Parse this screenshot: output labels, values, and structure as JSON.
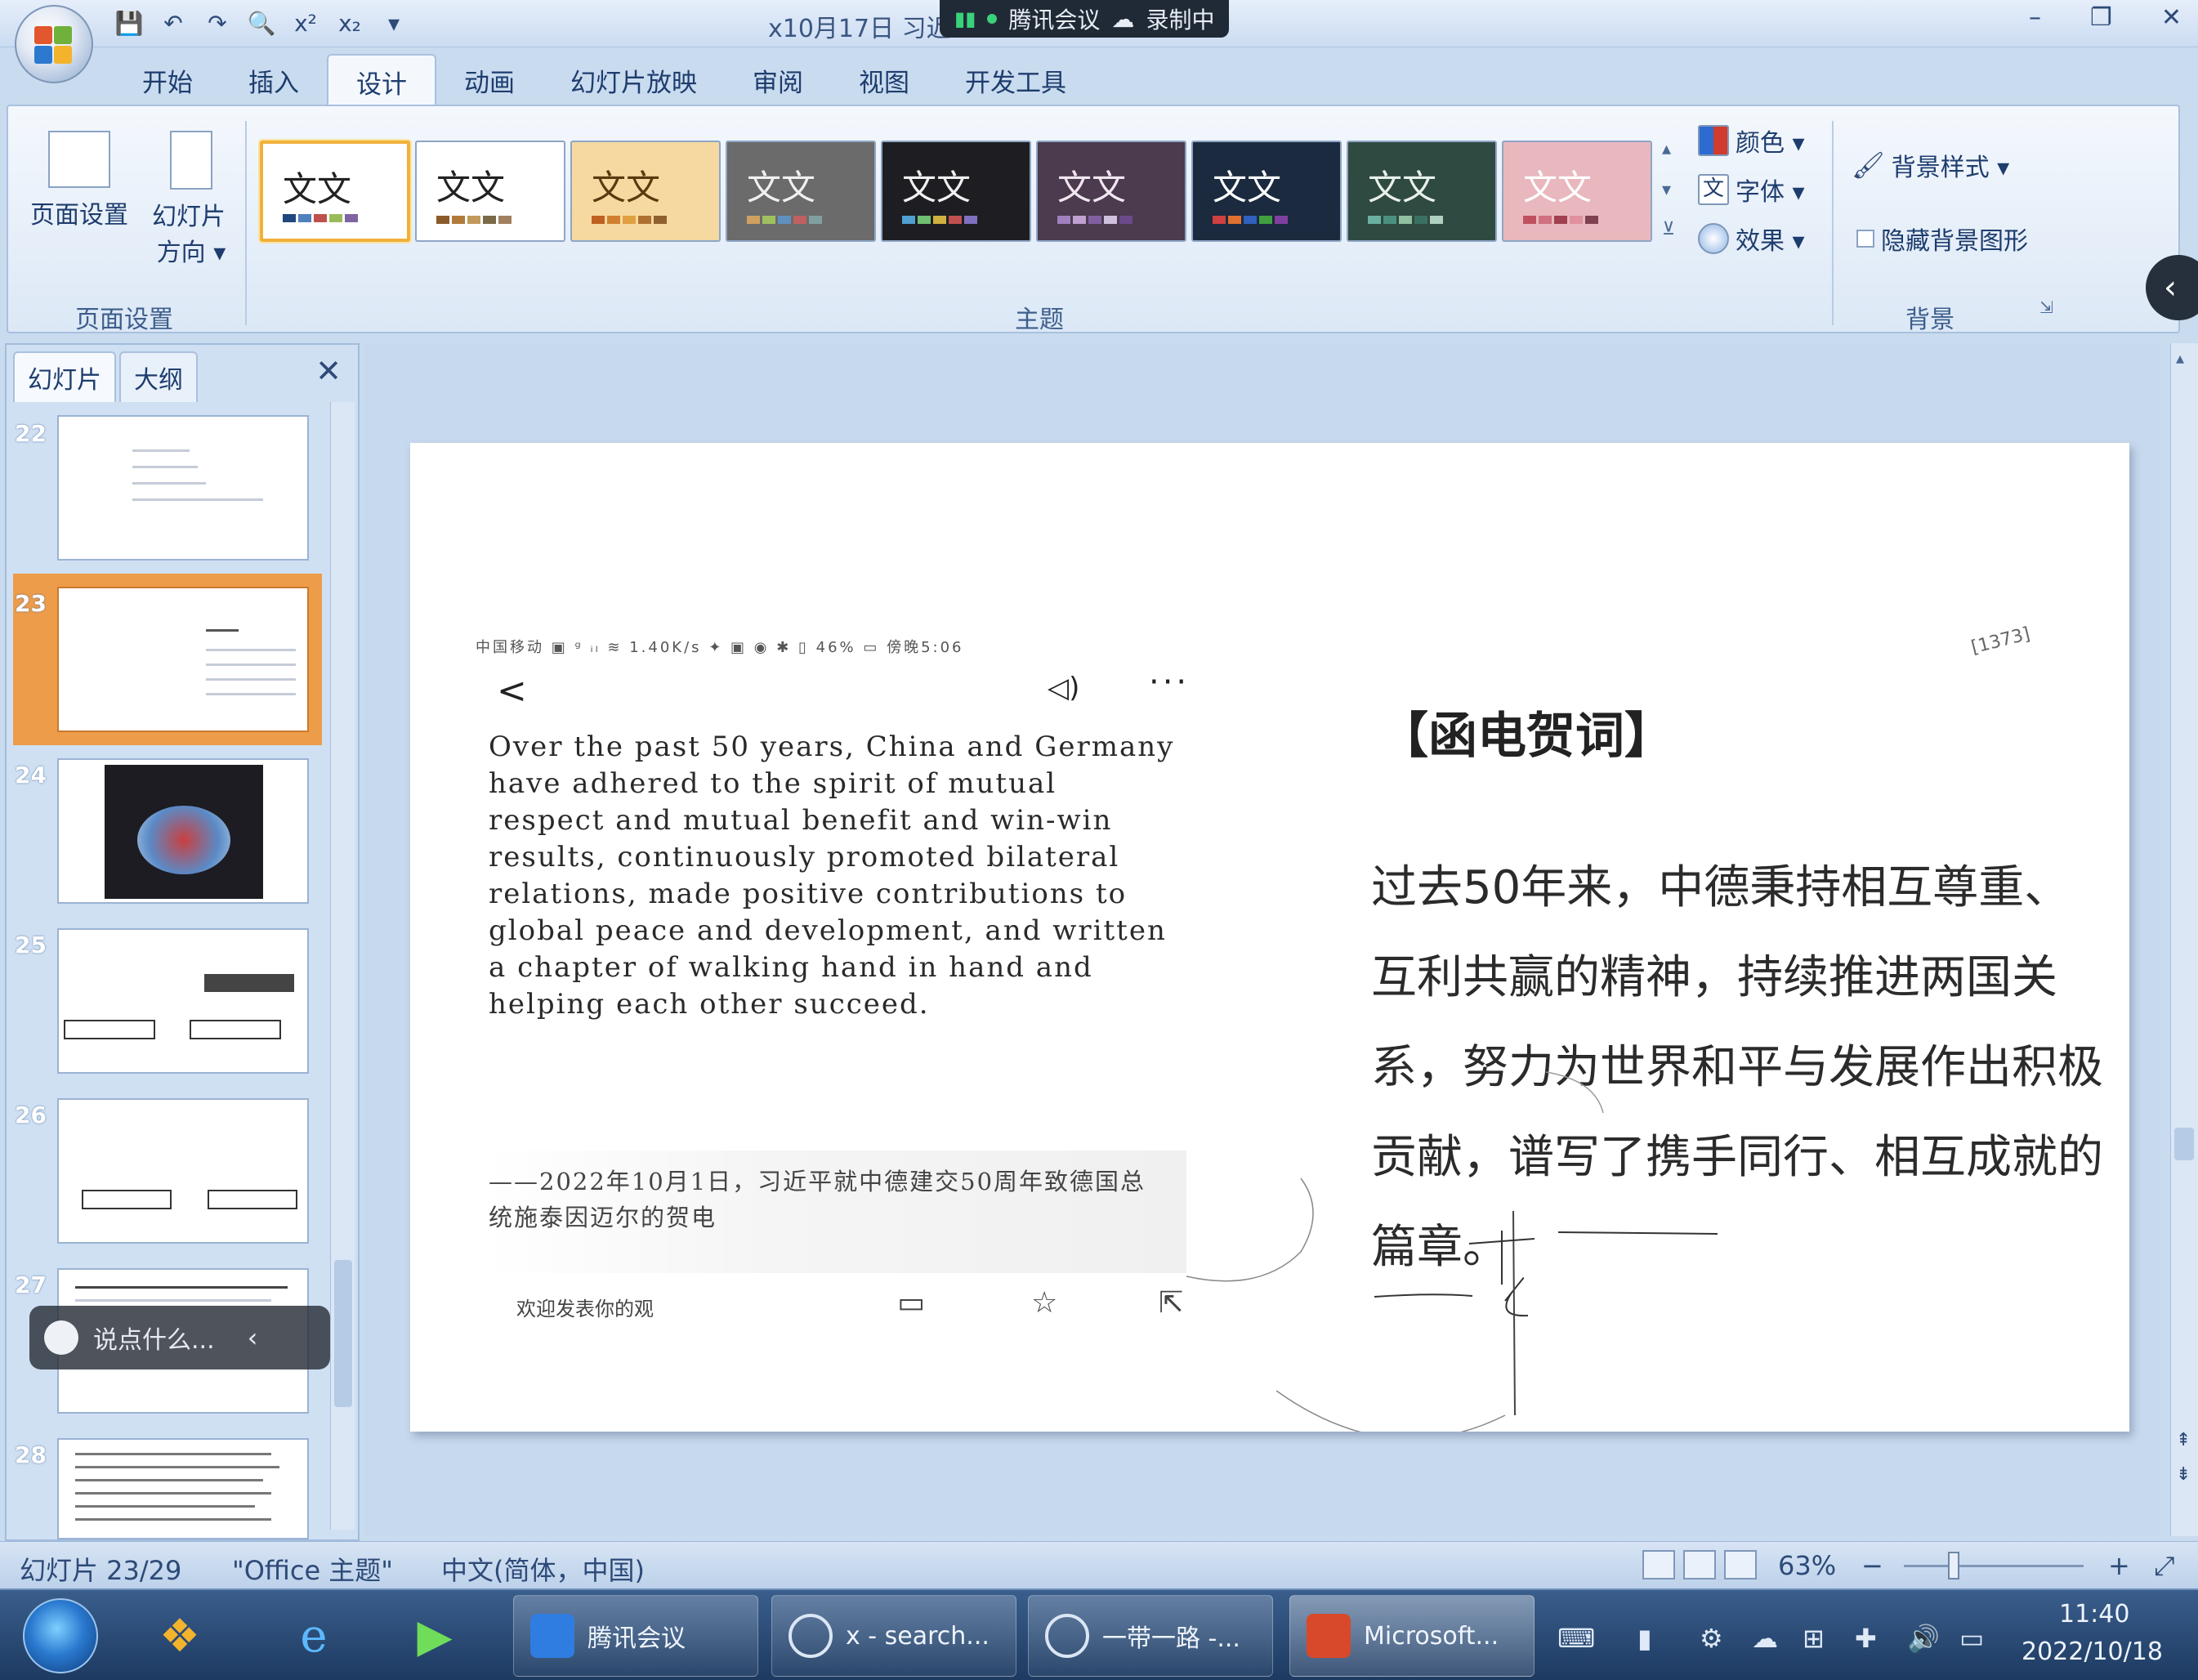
{
  "window": {
    "title": "x10月17日 习近...oft PowerPoint",
    "meeting_overlay": {
      "app": "腾讯会议",
      "status": "录制中"
    },
    "controls": [
      "–",
      "❐",
      "✕"
    ]
  },
  "quick_access": [
    "save-icon",
    "undo-icon",
    "redo-icon",
    "print-preview-icon",
    "superscript-icon",
    "subscript-icon",
    "customize-icon"
  ],
  "quick_access_glyphs": [
    "💾",
    "↶",
    "↷",
    "🔍",
    "x²",
    "x₂",
    "▾"
  ],
  "ribbon": {
    "tabs": [
      {
        "label": "开始"
      },
      {
        "label": "插入"
      },
      {
        "label": "设计",
        "active": true
      },
      {
        "label": "动画"
      },
      {
        "label": "幻灯片放映"
      },
      {
        "label": "审阅"
      },
      {
        "label": "视图"
      },
      {
        "label": "开发工具"
      }
    ],
    "page_setup_group": {
      "page_setup": "页面设置",
      "orientation": "幻灯片方向",
      "orientation_line2": "方向 ▾",
      "label": "页面设置"
    },
    "themes_group": {
      "label": "主题",
      "theme_text": "文文",
      "themes": [
        {
          "bg": "#ffffff",
          "text": "#222222",
          "selected": true,
          "sw": [
            "#1f497d",
            "#4f81bd",
            "#c0504d",
            "#9bbb59",
            "#8064a2"
          ]
        },
        {
          "bg": "#ffffff",
          "text": "#222222",
          "sw": [
            "#8b5a2b",
            "#b07b3b",
            "#c09a5a",
            "#7a6a4a",
            "#a08060"
          ]
        },
        {
          "bg": "#f6d9a0",
          "text": "#5a3a10",
          "sw": [
            "#c06020",
            "#d08030",
            "#e0a040",
            "#b07030",
            "#906030"
          ]
        },
        {
          "bg": "#6b6b6b",
          "text": "#f0f0f0",
          "sw": [
            "#d0a060",
            "#a0c060",
            "#6090c0",
            "#c06060",
            "#80a0a0"
          ]
        },
        {
          "bg": "#1e1e22",
          "text": "#f0f0f0",
          "sw": [
            "#4fa0d0",
            "#70c070",
            "#d0b040",
            "#c05050",
            "#8070c0"
          ]
        },
        {
          "bg": "#4c3a4e",
          "text": "#f0e6f0",
          "sw": [
            "#a080c0",
            "#c0a0d0",
            "#8060a0",
            "#d0c0e0",
            "#6a4a8a"
          ]
        },
        {
          "bg": "#1b2a3e",
          "text": "#ffffff",
          "sw": [
            "#d04040",
            "#e07030",
            "#3060c0",
            "#40a040",
            "#8040a0"
          ]
        },
        {
          "bg": "#2f4a40",
          "text": "#e8f0ea",
          "sw": [
            "#6ab0a0",
            "#4a9080",
            "#90c0a0",
            "#3a7060",
            "#b0d0c0"
          ]
        },
        {
          "bg": "#e8b8be",
          "text": "#ffffff",
          "sw": [
            "#c05060",
            "#d07080",
            "#a04050",
            "#e090a0",
            "#804050"
          ]
        }
      ],
      "side_commands": [
        {
          "label": "颜色 ▾",
          "icon": "color-scheme-icon"
        },
        {
          "label": "字体 ▾",
          "icon": "font-scheme-icon"
        },
        {
          "label": "效果 ▾",
          "icon": "effects-icon"
        }
      ]
    },
    "background_group": {
      "label": "背景",
      "styles": "背景样式 ▾",
      "hide_graphics": "隐藏背景图形"
    }
  },
  "slides_panel": {
    "tabs": [
      {
        "label": "幻灯片",
        "active": true
      },
      {
        "label": "大纲"
      }
    ],
    "close": "✕",
    "thumbnails": [
      {
        "number": "22"
      },
      {
        "number": "23",
        "selected": true
      },
      {
        "number": "24"
      },
      {
        "number": "25"
      },
      {
        "number": "26"
      },
      {
        "number": "27"
      },
      {
        "number": "28"
      }
    ],
    "chat_placeholder": "说点什么..."
  },
  "slide": {
    "phone_status": "中国移动 ▣ ᵍ ᵢₗ ≋  1.40K/s  ✦ ▣   ◉ ✱ ▯ 46% ▭ 傍晚5:06",
    "phone_back": "<",
    "phone_speaker": "◁)",
    "phone_more": "···",
    "english_text": "Over the past 50 years, China and Germany have adhered to the spirit of mutual respect and mutual benefit and win-win results, continuously promoted bilateral relations, made positive contributions to global peace and development, and written a chapter of walking hand in hand and helping each other succeed.",
    "signature": "——2022年10月1日，习近平就中德建交50周年致德国总统施泰因迈尔的贺电",
    "comment_placeholder": "欢迎发表你的观",
    "cn_heading": "【函电贺词】",
    "cn_body": "过去50年来，中德秉持相互尊重、互利共赢的精神，持续推进两国关系，努力为世界和平与发展作出积极贡献，谱写了携手同行、相互成就的篇章。",
    "page_mark": "[1373]"
  },
  "status_bar": {
    "slide_counter": "幻灯片 23/29",
    "theme": "\"Office 主题\"",
    "language": "中文(简体，中国)",
    "zoom": "63%",
    "zoom_out": "−",
    "zoom_in": "+"
  },
  "taskbar": {
    "tasks": [
      {
        "label": "腾讯会议",
        "icon": "tencent-meeting-icon"
      },
      {
        "label": "x - search...",
        "icon": "search-app-icon"
      },
      {
        "label": "一带一路 -...",
        "icon": "search-app-icon"
      },
      {
        "label": "Microsoft...",
        "icon": "powerpoint-icon"
      }
    ],
    "clock_time": "11:40",
    "clock_date": "2022/10/18"
  }
}
